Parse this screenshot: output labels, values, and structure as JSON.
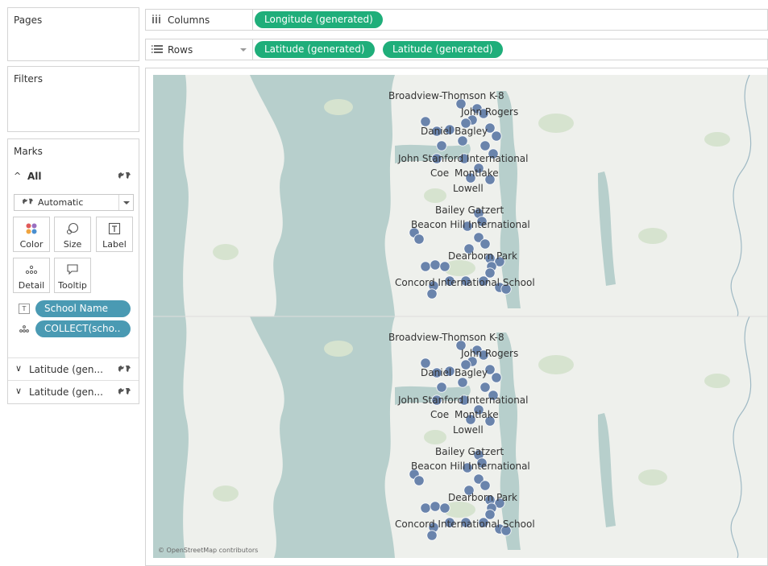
{
  "pages": {
    "title": "Pages"
  },
  "filters": {
    "title": "Filters"
  },
  "marks": {
    "title": "Marks",
    "all_label": "All",
    "mark_type": "Automatic",
    "buttons": {
      "color": "Color",
      "size": "Size",
      "label": "Label",
      "detail": "Detail",
      "tooltip": "Tooltip"
    },
    "pills": [
      {
        "icon": "label-icon",
        "text": "School Name"
      },
      {
        "icon": "detail-icon",
        "text": "COLLECT(scho.."
      }
    ],
    "layers": [
      {
        "label": "Latitude (gen..."
      },
      {
        "label": "Latitude (gen..."
      }
    ],
    "pill_color": "#4a9ab3"
  },
  "columns": {
    "label": "Columns",
    "pills": [
      "Longitude (generated)"
    ]
  },
  "rows": {
    "label": "Rows",
    "pills": [
      "Latitude (generated)",
      "Latitude (generated)"
    ]
  },
  "field_pill_color": "#1fae7a",
  "map": {
    "water_color": "#b7cfcc",
    "land_color": "#eef0ec",
    "point_color": "#6a84ac",
    "attribution": "© OpenStreetMap contributors",
    "school_labels": [
      "Broadview-Thomson K-8",
      "John Rogers",
      "Daniel Bagley",
      "John Stanford International",
      "Coe",
      "Montlake",
      "Lowell",
      "Bailey Gatzert",
      "Beacon Hill International",
      "Dearborn Park",
      "Concord International School"
    ]
  }
}
